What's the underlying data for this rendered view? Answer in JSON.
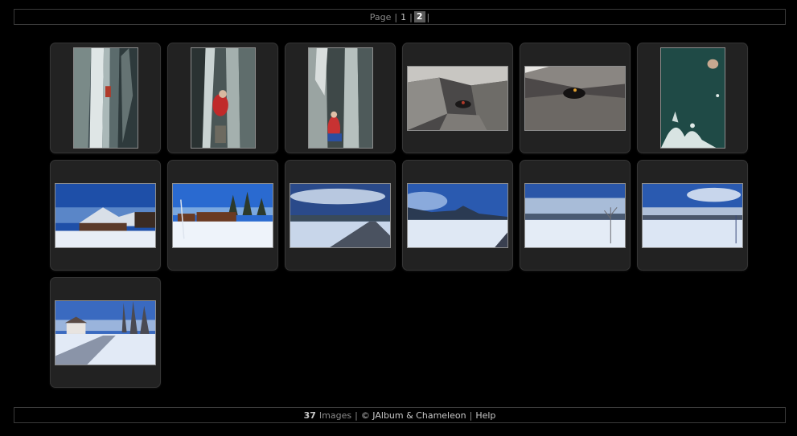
{
  "pager": {
    "label": "Page",
    "pages": [
      "1",
      "2"
    ],
    "current": "2"
  },
  "footer": {
    "count": "37",
    "images_label": "Images",
    "credit": "© JAlbum & Chameleon",
    "help": "Help"
  },
  "thumbnails": [
    {
      "icon": "ice-crevasse-photo"
    },
    {
      "icon": "ice-crevasse-climber-photo"
    },
    {
      "icon": "ice-crevasse-climber-photo"
    },
    {
      "icon": "cave-interior-photo"
    },
    {
      "icon": "cave-tunnel-photo"
    },
    {
      "icon": "water-splash-photo"
    },
    {
      "icon": "snowy-village-mountain-photo"
    },
    {
      "icon": "snowy-cabins-photo"
    },
    {
      "icon": "snowy-road-sky-photo"
    },
    {
      "icon": "snowy-field-mountains-photo"
    },
    {
      "icon": "snowy-field-fog-photo"
    },
    {
      "icon": "snowy-field-clouds-photo"
    },
    {
      "icon": "snowy-road-houses-photo"
    }
  ]
}
